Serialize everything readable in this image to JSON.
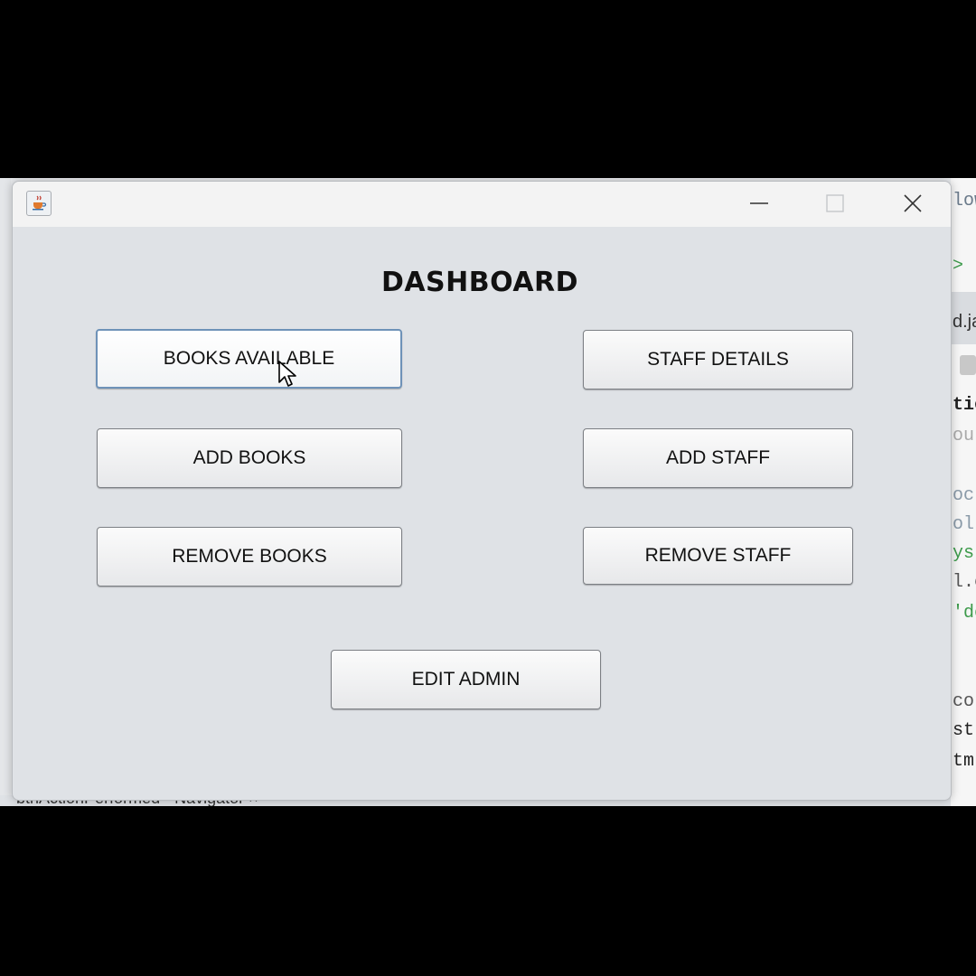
{
  "window": {
    "heading": "DASHBOARD",
    "controls": [
      "minimize",
      "maximize",
      "close"
    ]
  },
  "buttons": {
    "books_available": "BOOKS AVAILABLE",
    "staff_details": "STAFF DETAILS",
    "add_books": "ADD BOOKS",
    "add_staff": "ADD STAFF",
    "remove_books": "REMOVE BOOKS",
    "remove_staff": "REMOVE STAFF",
    "edit_admin": "EDIT ADMIN"
  },
  "background_ide": {
    "lines": [
      "low",
      "d.ja",
      "tic",
      "ou",
      "oc",
      "ol",
      "ys",
      "l.c",
      "'de",
      "co",
      "str",
      "tm"
    ],
    "navigator_text": "btnActionPerformed - Navigator ×"
  },
  "icons": {
    "app": "java-cup-icon",
    "minimize": "minimize-icon",
    "maximize": "maximize-icon",
    "close": "close-icon",
    "cursor": "mouse-pointer-icon"
  },
  "colors": {
    "window_bg": "#dfe2e6",
    "focus_border": "#6e92b8"
  }
}
